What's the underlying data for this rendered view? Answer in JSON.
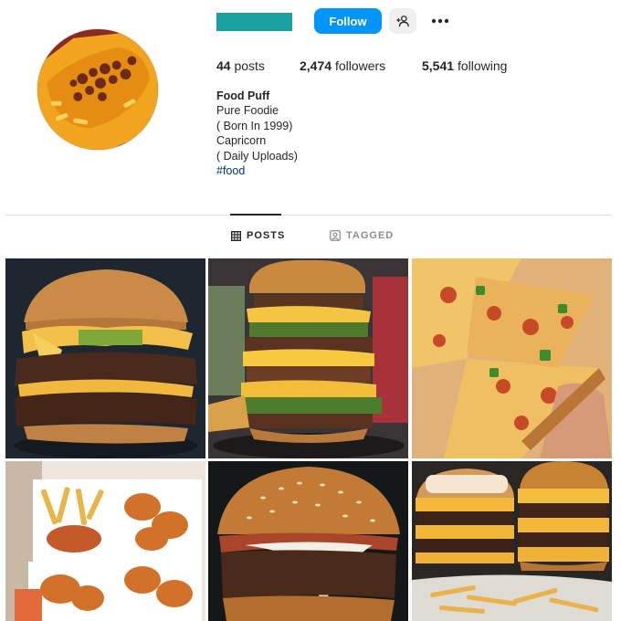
{
  "profile": {
    "follow_label": "Follow",
    "stats": {
      "posts_count": "44",
      "posts_label": "posts",
      "followers_count": "2,474",
      "followers_label": "followers",
      "following_count": "5,541",
      "following_label": "following"
    },
    "bio": {
      "name": "Food Puff",
      "lines": [
        "Pure Foodie",
        "( Born In 1999)",
        "Capricorn",
        "( Daily Uploads)"
      ],
      "hashtag": "#food"
    }
  },
  "tabs": [
    {
      "label": "POSTS",
      "active": true,
      "icon": "grid-icon"
    },
    {
      "label": "TAGGED",
      "active": false,
      "icon": "tag-icon"
    }
  ],
  "posts": [
    {
      "subject": "double cheeseburger with pickles"
    },
    {
      "subject": "tall stacked burger tower"
    },
    {
      "subject": "pizza slices in box"
    },
    {
      "subject": "fried chicken and fries"
    },
    {
      "subject": "sesame bun burger with melted cheese"
    },
    {
      "subject": "two loaded cheeseburgers with fries"
    }
  ],
  "colors": {
    "accent": "#0095f6",
    "username_redaction": "#1ba2a0",
    "hashtag": "#00376b",
    "divider": "#dbdbdb"
  }
}
